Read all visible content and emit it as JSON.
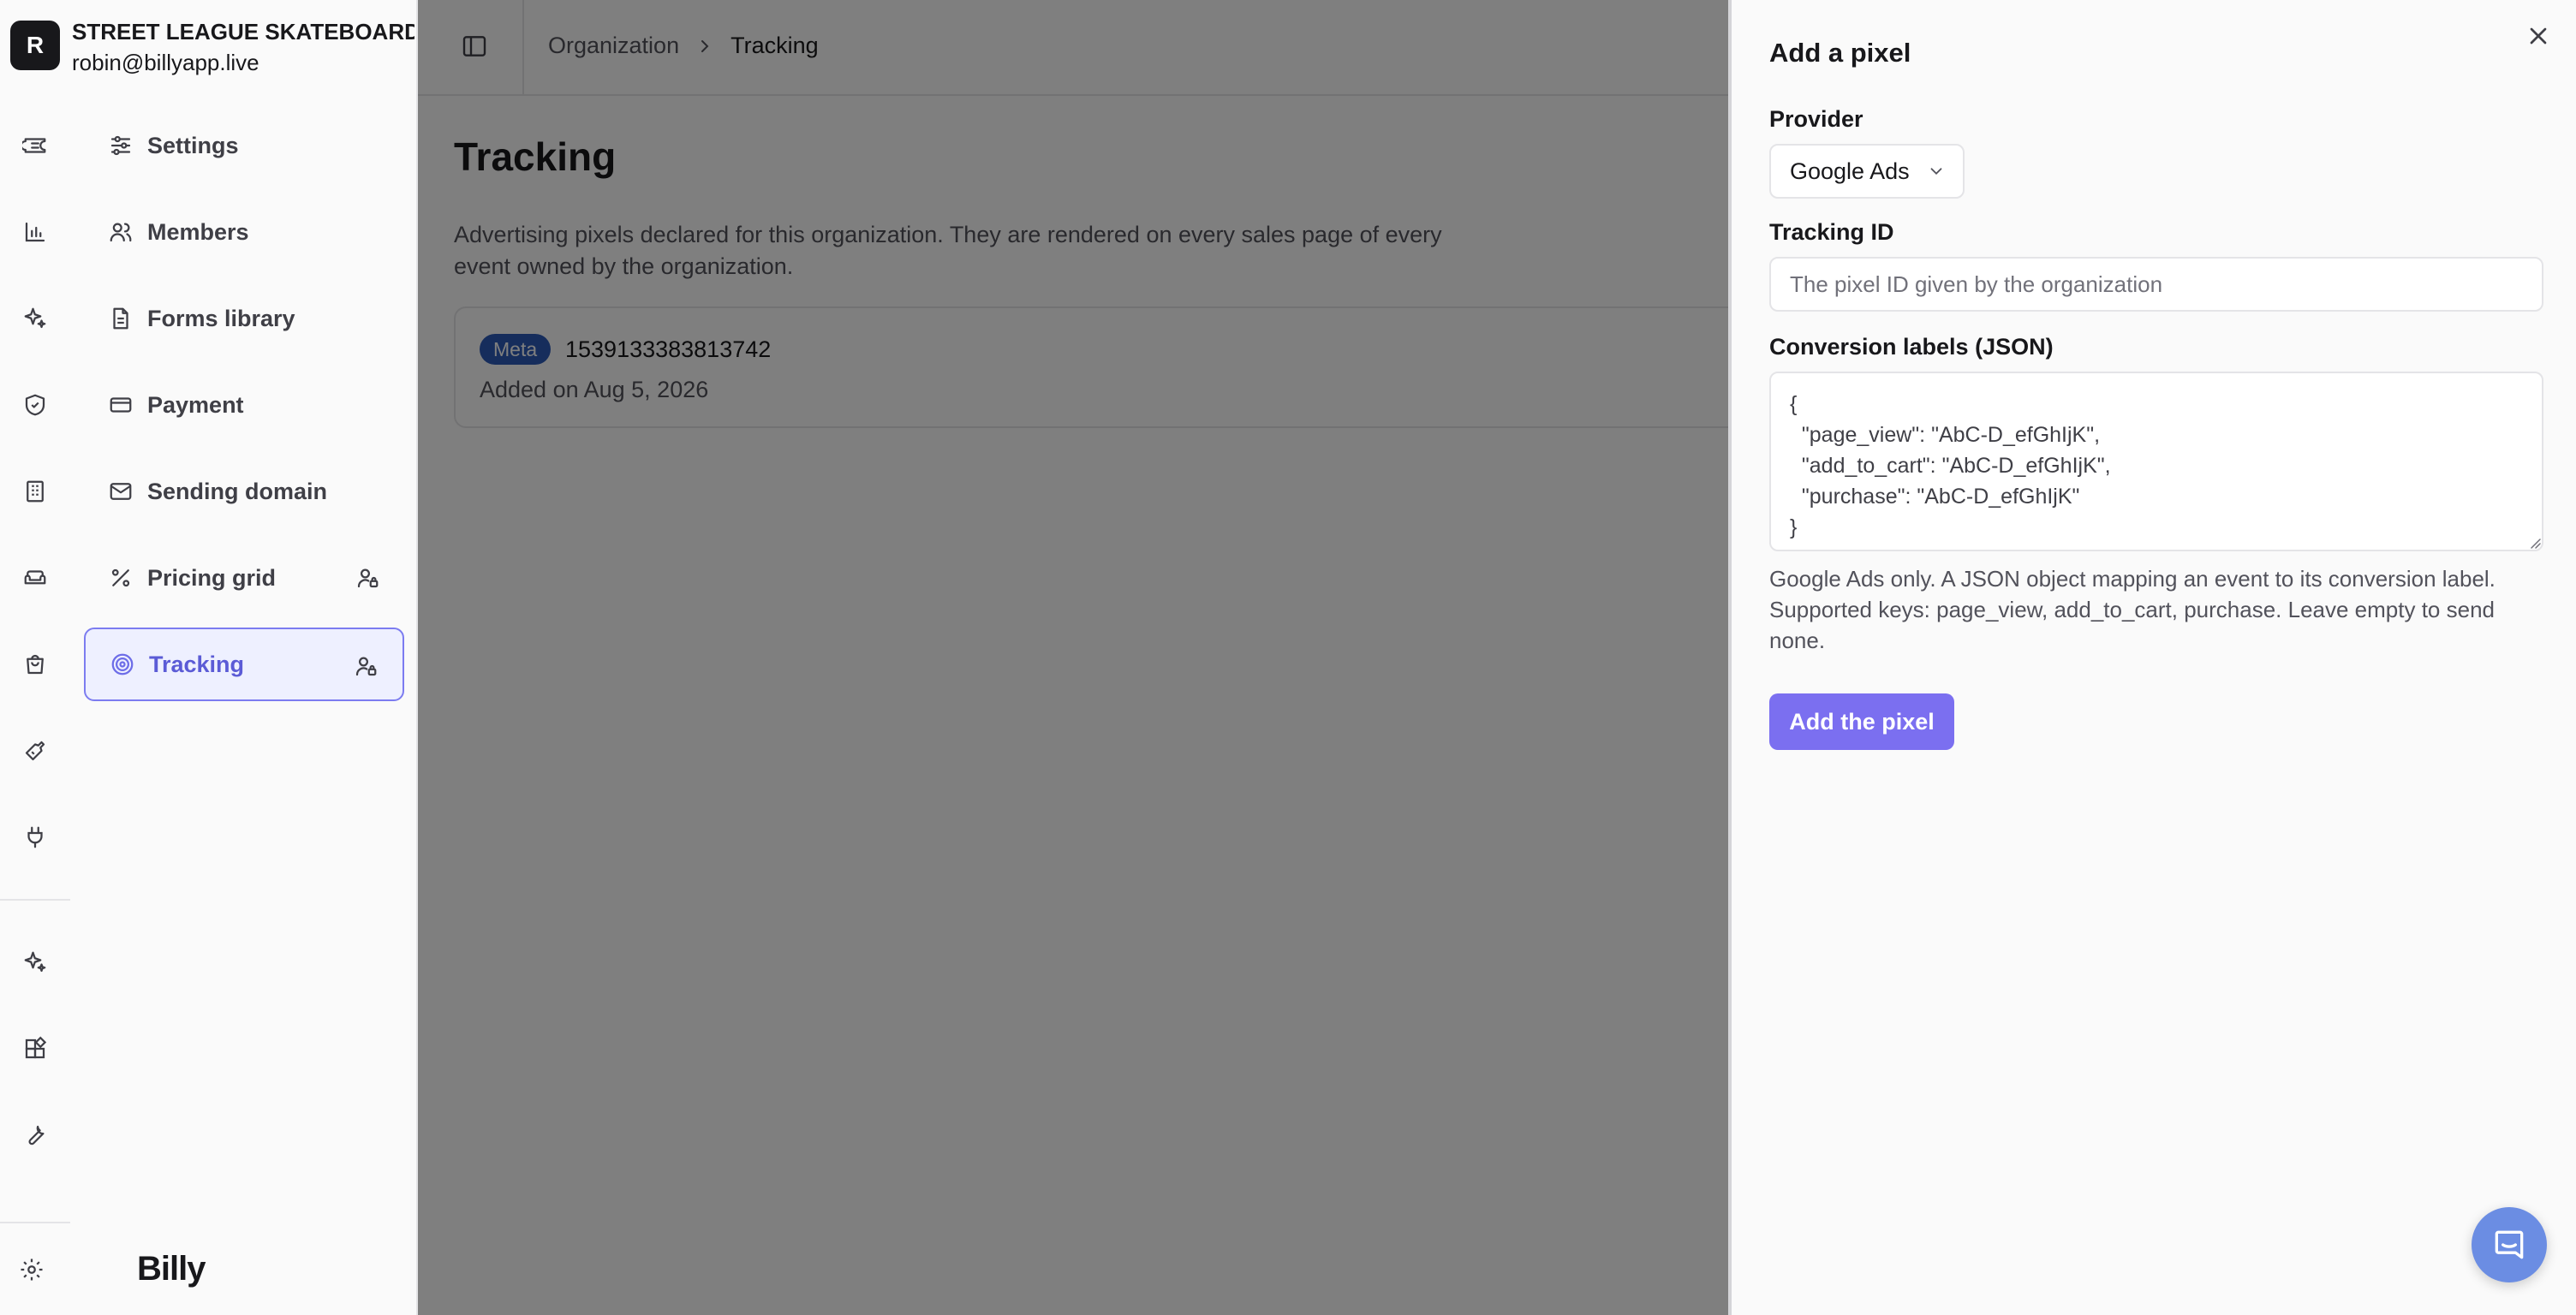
{
  "org": {
    "initial": "R",
    "name": "STREET LEAGUE SKATEBOARDI",
    "email": "robin@billyapp.live"
  },
  "rail_icons": [
    "ticket-icon",
    "chart-icon",
    "sparkles-icon",
    "shield-icon",
    "building-icon",
    "sofa-icon",
    "shopping-bag-icon",
    "ticket-tag-icon",
    "plug-icon",
    "sparkles-icon",
    "widgets-icon",
    "wrench-icon",
    "gear-icon"
  ],
  "sidebar": {
    "items": [
      {
        "label": "Settings",
        "icon": "sliders-icon"
      },
      {
        "label": "Members",
        "icon": "users-icon"
      },
      {
        "label": "Forms library",
        "icon": "document-icon"
      },
      {
        "label": "Payment",
        "icon": "credit-card-icon"
      },
      {
        "label": "Sending domain",
        "icon": "mail-icon"
      },
      {
        "label": "Pricing grid",
        "icon": "percent-icon"
      },
      {
        "label": "Tracking",
        "icon": "target-icon"
      }
    ],
    "active": "Tracking"
  },
  "brand": "Billy",
  "breadcrumb": {
    "parent": "Organization",
    "current": "Tracking"
  },
  "page": {
    "title": "Tracking",
    "description": "Advertising pixels declared for this organization. They are rendered on every sales page of every event owned by the organization."
  },
  "pixels": [
    {
      "provider": "Meta",
      "id": "1539133383813742",
      "added": "Added on Aug 5, 2026"
    }
  ],
  "colors": {
    "accent": "#7b6ff0",
    "meta_badge": "#2d5bb8",
    "active_item_bg": "#eef0ff"
  },
  "drawer": {
    "title": "Add a pixel",
    "provider_label": "Provider",
    "provider_value": "Google Ads",
    "tracking_label": "Tracking ID",
    "tracking_placeholder": "The pixel ID given by the organization",
    "tracking_value": "",
    "json_label": "Conversion labels (JSON)",
    "json_value": "{\n  \"page_view\": \"AbC-D_efGhIjK\",\n  \"add_to_cart\": \"AbC-D_efGhIjK\",\n  \"purchase\": \"AbC-D_efGhIjK\"\n}",
    "help": "Google Ads only. A JSON object mapping an event to its conversion label. Supported keys: page_view, add_to_cart, purchase. Leave empty to send none.",
    "submit": "Add the pixel"
  }
}
